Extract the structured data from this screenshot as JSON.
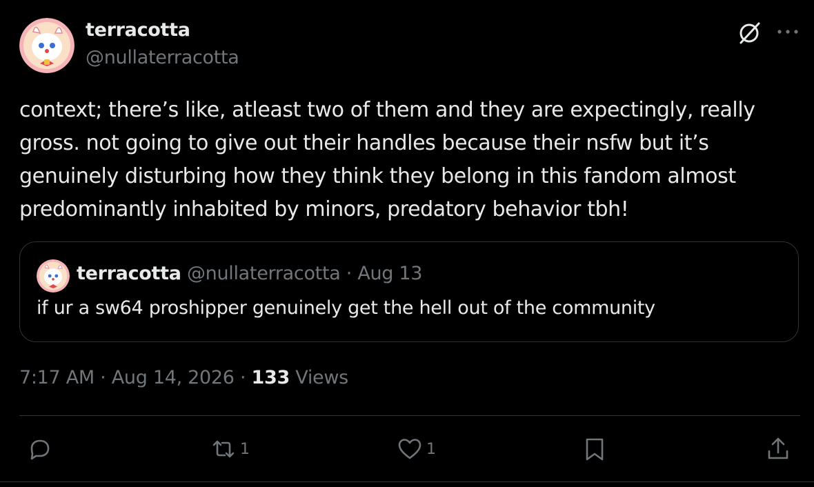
{
  "tweet": {
    "display_name": "terracotta",
    "handle": "@nullaterracotta",
    "text": "context; there’s like, atleast two of them and they are expectingly, really gross. not going to give out their handles because their nsfw but it’s genuinely disturbing how they think they belong in this fandom almost predominantly inhabited by minors, predatory behavior tbh!",
    "timestamp": "7:17 AM · Aug 14, 2026 · ",
    "views_count": "133",
    "views_label": " Views"
  },
  "quote": {
    "display_name": "terracotta",
    "handle_date": " @nullaterracotta · Aug 13",
    "text": "if ur a sw64 proshipper genuinely get the hell out of the community"
  },
  "actions": {
    "reply_count": "",
    "retweet_count": "1",
    "like_count": "1"
  },
  "icons": {
    "top_right": [
      "grok-icon",
      "more-icon"
    ],
    "actions": [
      "reply-icon",
      "retweet-icon",
      "like-icon",
      "bookmark-icon",
      "share-icon"
    ]
  },
  "colors": {
    "background": "#000000",
    "text_primary": "#e7e9ea",
    "text_secondary": "#71767b",
    "border": "#2f3336"
  }
}
